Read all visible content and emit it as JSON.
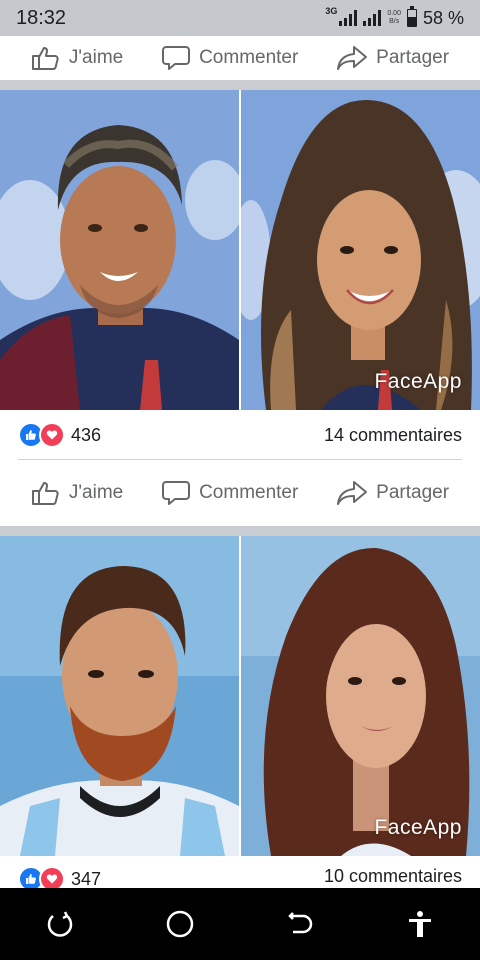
{
  "status_bar": {
    "time": "18:32",
    "network": "3G",
    "speed_value": "0.00",
    "speed_unit": "B/s",
    "battery": "58 %"
  },
  "actions": {
    "like": "J'aime",
    "comment": "Commenter",
    "share": "Partager"
  },
  "posts": [
    {
      "watermark": "FaceApp",
      "reactions_count": "436",
      "comments_label": "14 commentaires"
    },
    {
      "watermark": "FaceApp",
      "reactions_count": "347",
      "comments_label": "10 commentaires"
    }
  ],
  "colors": {
    "like_blue": "#1877f2",
    "love_red": "#f33e58",
    "feed_gap": "#c9ccd1"
  }
}
